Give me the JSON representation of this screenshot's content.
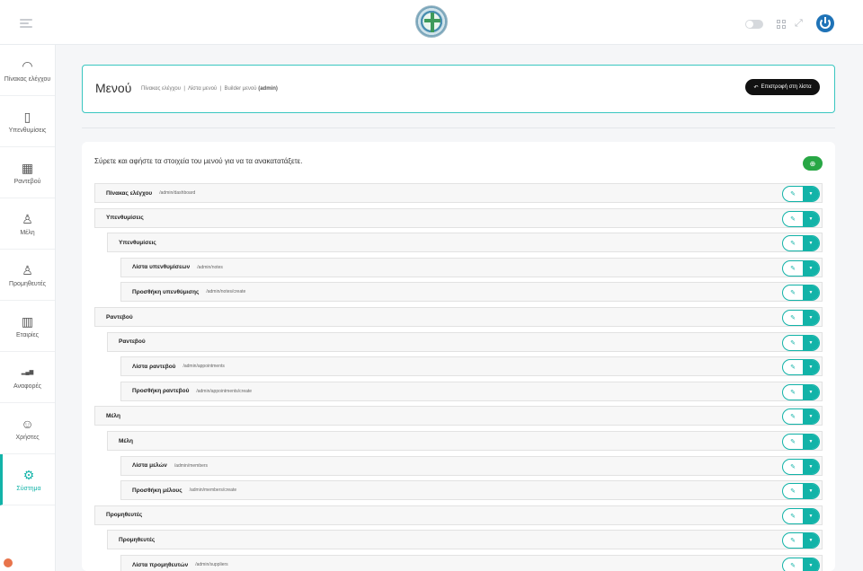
{
  "topbar": {
    "logo_icon": "clinic-logo-icon",
    "theme_toggle": false
  },
  "sidebar": {
    "items": [
      {
        "label": "Πίνακας ελέγχου",
        "icon": "dashboard-gauge-icon",
        "glyph": "◠"
      },
      {
        "label": "Υπενθυμίσεις",
        "icon": "document-icon",
        "glyph": "▯"
      },
      {
        "label": "Ραντεβού",
        "icon": "calendar-icon",
        "glyph": "▦"
      },
      {
        "label": "Μέλη",
        "icon": "user-icon",
        "glyph": "♙"
      },
      {
        "label": "Προμηθευτές",
        "icon": "users-icon",
        "glyph": "♙"
      },
      {
        "label": "Εταιρίες",
        "icon": "building-icon",
        "glyph": "▥"
      },
      {
        "label": "Αναφορές",
        "icon": "bar-chart-icon",
        "glyph": "▂▄▆"
      },
      {
        "label": "Χρήστες",
        "icon": "user-circle-icon",
        "glyph": "☺"
      },
      {
        "label": "Σύστημα",
        "icon": "gear-icon",
        "glyph": "⚙",
        "active": true
      }
    ]
  },
  "header": {
    "title": "Μενού",
    "breadcrumb": [
      "Πίνακας ελέγχου",
      "Λίστα μενού"
    ],
    "breadcrumb_current": "Builder μενού",
    "breadcrumb_scope": "(admin)",
    "back_button": "Επιστροφή στη λίστα"
  },
  "main": {
    "instructions": "Σύρετε και αφήστε τα στοιχεία του μενού για να τα ανακατατάξετε.",
    "add_icon": "plus-circle-icon",
    "accent": "#12b3a8",
    "menu_items": [
      {
        "title": "Πίνακας ελέγχου",
        "url": "/admin/dashboard",
        "level": 0
      },
      {
        "title": "Υπενθυμίσεις",
        "url": "",
        "level": 0
      },
      {
        "title": "Υπενθυμίσεις",
        "url": "",
        "level": 1
      },
      {
        "title": "Λίστα υπενθυμίσεων",
        "url": "/admin/notes",
        "level": 2
      },
      {
        "title": "Προσθήκη υπενθύμισης",
        "url": "/admin/notes/create",
        "level": 2
      },
      {
        "title": "Ραντεβού",
        "url": "",
        "level": 0
      },
      {
        "title": "Ραντεβού",
        "url": "",
        "level": 1
      },
      {
        "title": "Λίστα ραντεβού",
        "url": "/admin/appointments",
        "level": 2
      },
      {
        "title": "Προσθήκη ραντεβού",
        "url": "/admin/appointments/create",
        "level": 2
      },
      {
        "title": "Μέλη",
        "url": "",
        "level": 0
      },
      {
        "title": "Μέλη",
        "url": "",
        "level": 1
      },
      {
        "title": "Λίστα μελών",
        "url": "/admin/members",
        "level": 2
      },
      {
        "title": "Προσθήκη μέλους",
        "url": "/admin/members/create",
        "level": 2
      },
      {
        "title": "Προμηθευτές",
        "url": "",
        "level": 0
      },
      {
        "title": "Προμηθευτές",
        "url": "",
        "level": 1
      },
      {
        "title": "Λίστα προμηθευτών",
        "url": "/admin/suppliers",
        "level": 2
      }
    ]
  }
}
